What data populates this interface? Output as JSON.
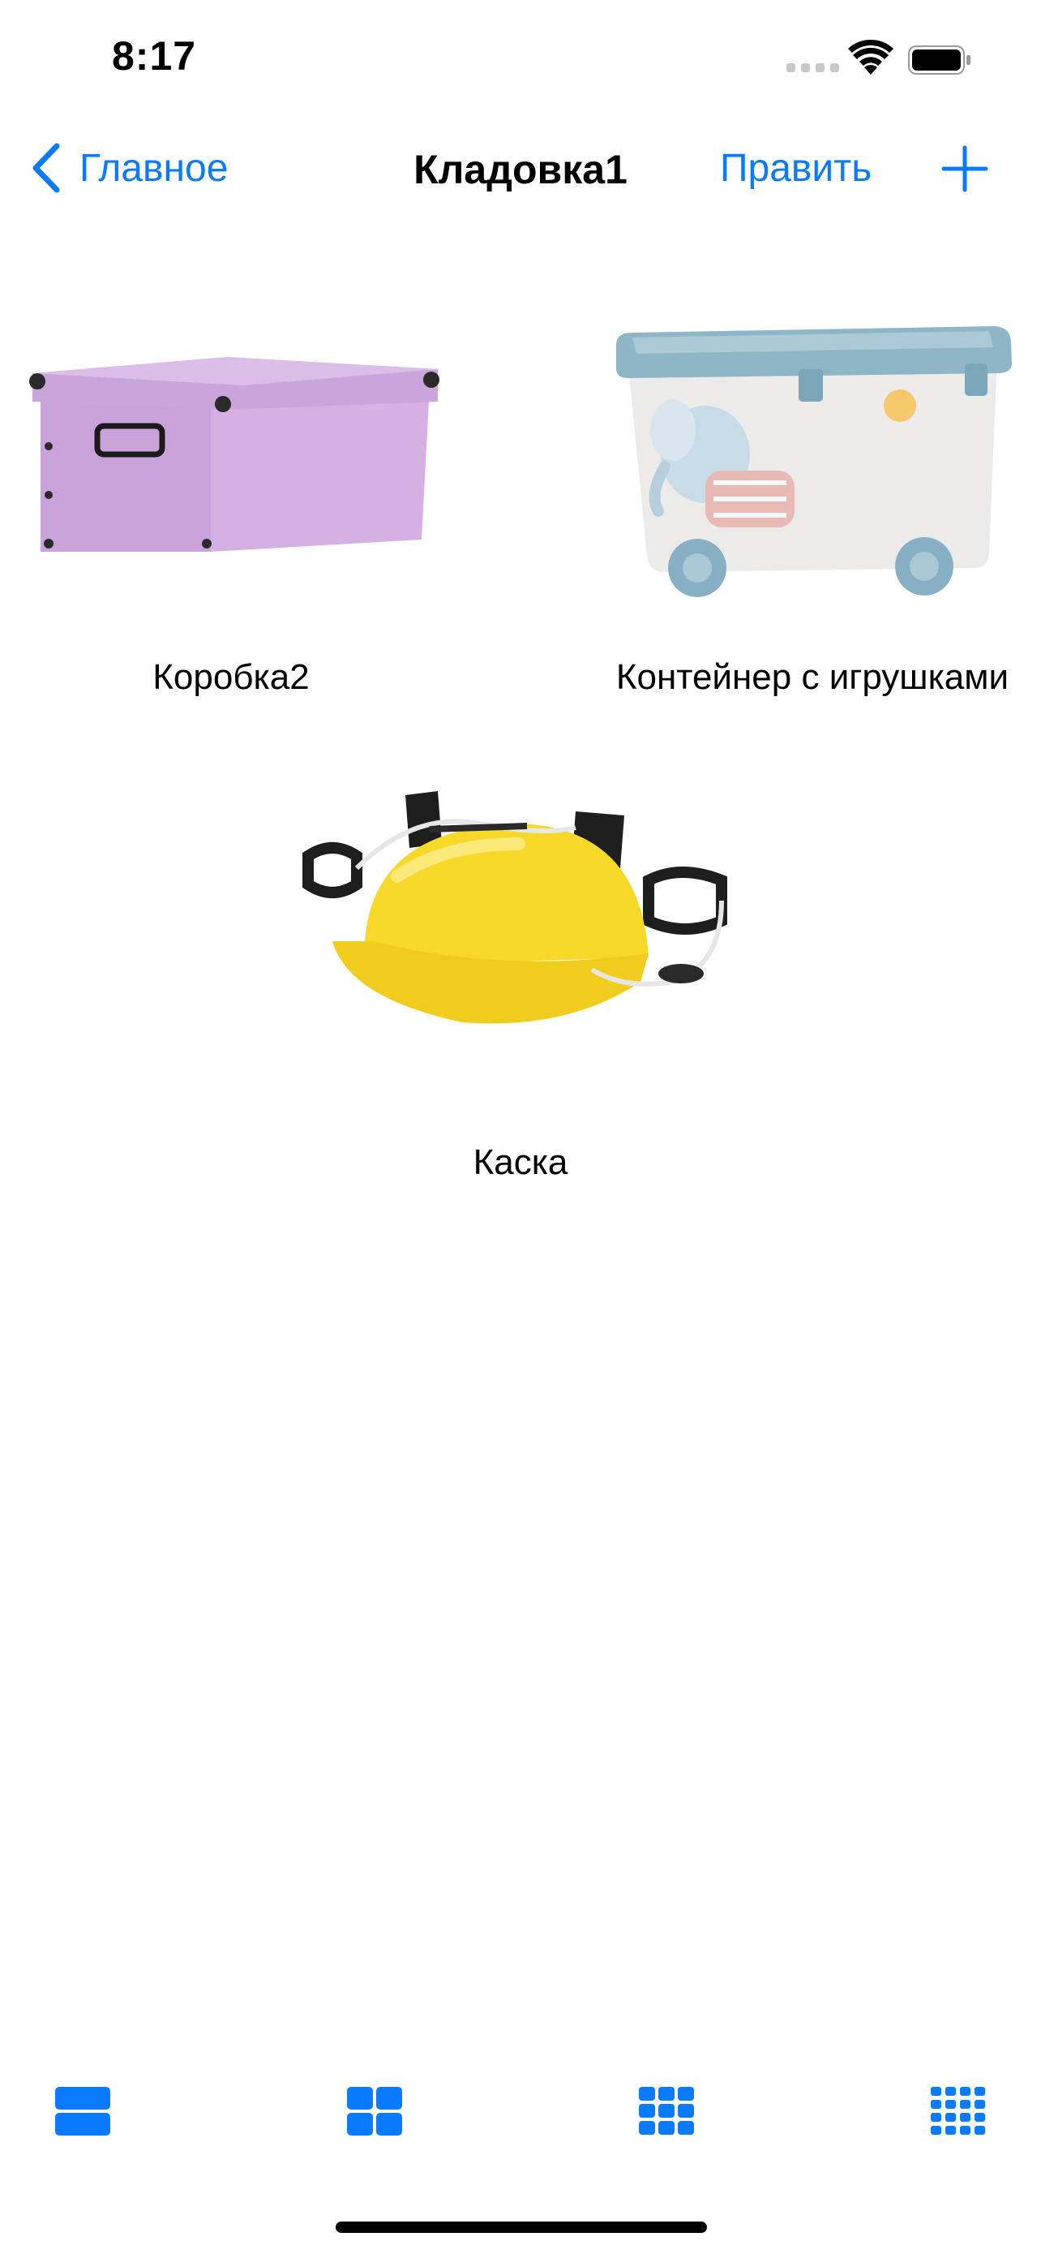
{
  "status_bar": {
    "time": "8:17",
    "signal_icon": "cellular-signal-icon",
    "wifi_icon": "wifi-icon",
    "battery_icon": "battery-icon"
  },
  "nav": {
    "back_label": "Главное",
    "back_icon": "chevron-left-icon",
    "title": "Кладовка1",
    "edit_label": "Править",
    "add_icon": "plus-icon"
  },
  "items": [
    {
      "label": "Коробка2",
      "icon": "purple-storage-box"
    },
    {
      "label": "Контейнер с игрушками",
      "icon": "toy-container-on-wheels"
    },
    {
      "label": "Каска",
      "icon": "yellow-drinking-helmet"
    }
  ],
  "toolbar": [
    {
      "icon": "list-layout-icon"
    },
    {
      "icon": "grid-2-icon"
    },
    {
      "icon": "grid-3-icon"
    },
    {
      "icon": "grid-4-icon"
    }
  ],
  "colors": {
    "accent": "#0a7aff",
    "background": "#ffffff",
    "text": "#000000"
  }
}
